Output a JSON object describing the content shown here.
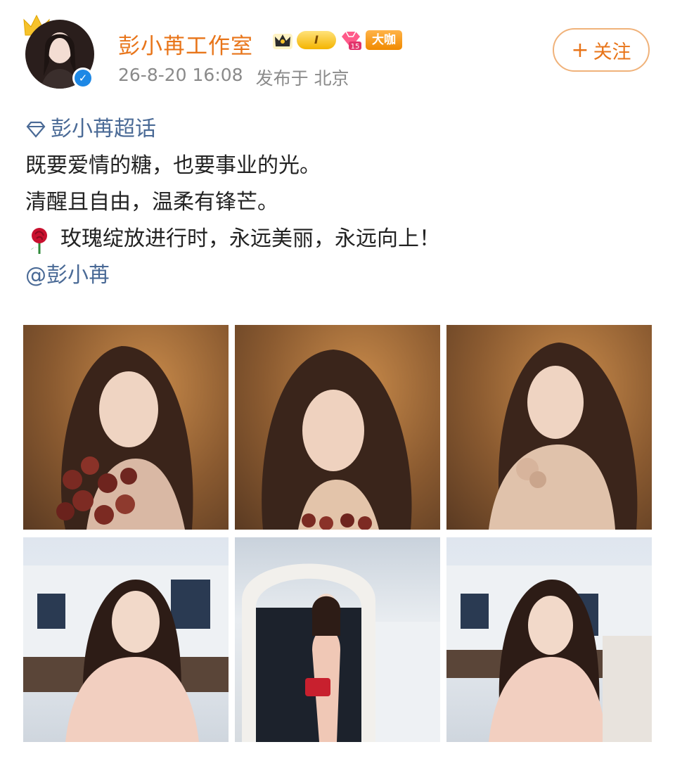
{
  "header": {
    "name": "彭小苒工作室",
    "level": "I",
    "diamond_level": "15",
    "big_badge": "大咖",
    "timestamp": "26-8-20 16:08",
    "published_in": "发布于 北京",
    "follow_label": "关注",
    "follow_icon": "plus-icon"
  },
  "post": {
    "topic": "彭小苒超话",
    "line1": "既要爱情的糖，也要事业的光。",
    "line2": "清醒且自由，温柔有锋芒。",
    "line3": "玫瑰绽放进行时，永远美丽，永远向上！",
    "mention": "@彭小苒"
  },
  "photos": [
    "photo-1",
    "photo-2",
    "photo-3",
    "photo-4",
    "photo-5",
    "photo-6"
  ],
  "colors": {
    "name": "#e8751a",
    "link": "#4a6a96",
    "meta": "#8a8a8a",
    "follow_border": "#f0b27a"
  }
}
